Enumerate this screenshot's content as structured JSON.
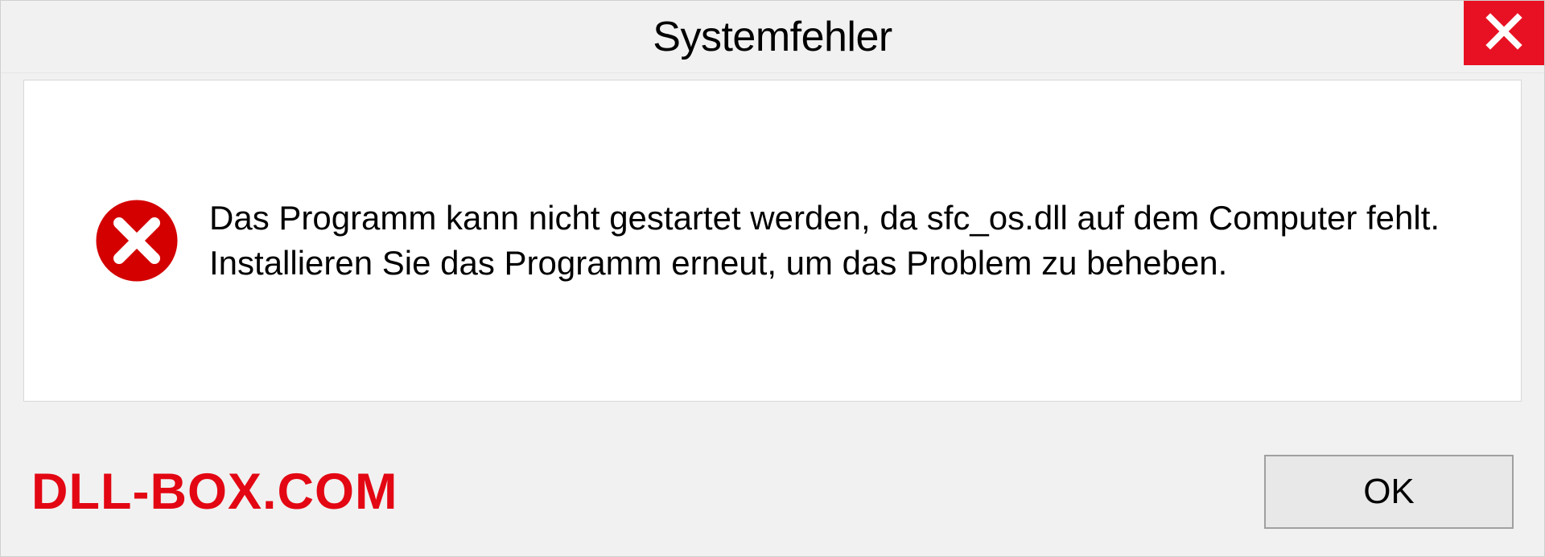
{
  "dialog": {
    "title": "Systemfehler",
    "message": "Das Programm kann nicht gestartet werden, da sfc_os.dll auf dem Computer fehlt. Installieren Sie das Programm erneut, um das Problem zu beheben.",
    "ok_label": "OK"
  },
  "watermark": "DLL-BOX.COM"
}
